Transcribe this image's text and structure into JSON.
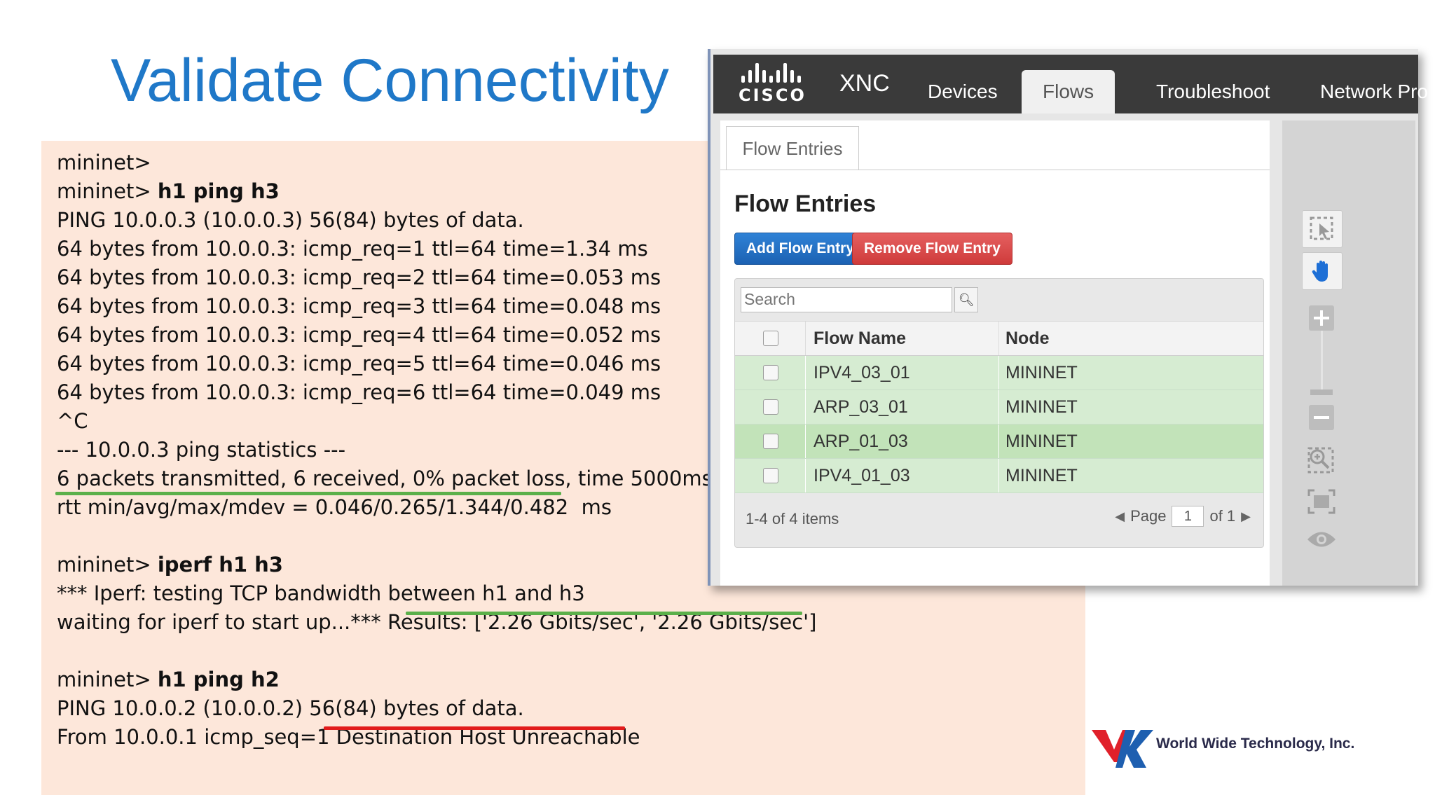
{
  "slide": {
    "title": "Validate Connectivity"
  },
  "terminal": {
    "lines": [
      {
        "prompt": "mininet>",
        "cmd": ""
      },
      {
        "prompt": "mininet> ",
        "cmd": "h1 ping h3"
      },
      {
        "prompt": "PING 10.0.0.3 (10.0.0.3) 56(84) bytes of data.",
        "cmd": ""
      },
      {
        "prompt": "64 bytes from 10.0.0.3: icmp_req=1 ttl=64 time=1.34 ms",
        "cmd": ""
      },
      {
        "prompt": "64 bytes from 10.0.0.3: icmp_req=2 ttl=64 time=0.053 ms",
        "cmd": ""
      },
      {
        "prompt": "64 bytes from 10.0.0.3: icmp_req=3 ttl=64 time=0.048 ms",
        "cmd": ""
      },
      {
        "prompt": "64 bytes from 10.0.0.3: icmp_req=4 ttl=64 time=0.052 ms",
        "cmd": ""
      },
      {
        "prompt": "64 bytes from 10.0.0.3: icmp_req=5 ttl=64 time=0.046 ms",
        "cmd": ""
      },
      {
        "prompt": "64 bytes from 10.0.0.3: icmp_req=6 ttl=64 time=0.049 ms",
        "cmd": ""
      },
      {
        "prompt": "^C",
        "cmd": ""
      },
      {
        "prompt": "--- 10.0.0.3 ping statistics ---",
        "cmd": ""
      },
      {
        "prompt": "6 packets transmitted, 6 received, 0% packet loss, time 5000ms",
        "cmd": ""
      },
      {
        "prompt": "rtt min/avg/max/mdev = 0.046/0.265/1.344/0.482  ms",
        "cmd": ""
      },
      {
        "prompt": "",
        "cmd": ""
      },
      {
        "prompt": "mininet> ",
        "cmd": "iperf h1 h3"
      },
      {
        "prompt": "*** Iperf: testing TCP bandwidth between h1 and h3",
        "cmd": ""
      },
      {
        "prompt": "waiting for iperf to start up...*** Results: ['2.26 Gbits/sec', '2.26 Gbits/sec']",
        "cmd": ""
      },
      {
        "prompt": "",
        "cmd": ""
      },
      {
        "prompt": "mininet> ",
        "cmd": "h1 ping h2"
      },
      {
        "prompt": "PING 10.0.0.2 (10.0.0.2) 56(84) bytes of data.",
        "cmd": ""
      },
      {
        "prompt": "From 10.0.0.1 icmp_seq=1 Destination Host Unreachable",
        "cmd": ""
      }
    ],
    "underline_colors": {
      "ok": "#5bb04a",
      "error": "#e21b1b"
    }
  },
  "xnc": {
    "brand": "cisco",
    "app_name": "XNC",
    "nav_tabs": [
      "Devices",
      "Flows",
      "Troubleshoot",
      "Network Pro"
    ],
    "active_tab": "Flows",
    "subtab": "Flow Entries",
    "section_title": "Flow Entries",
    "add_button": "Add Flow Entry",
    "remove_button": "Remove Flow Entry",
    "search_placeholder": "Search",
    "columns": [
      "Flow Name",
      "Node"
    ],
    "rows": [
      {
        "flow_name": "IPV4_03_01",
        "node": "MININET"
      },
      {
        "flow_name": "ARP_03_01",
        "node": "MININET"
      },
      {
        "flow_name": "ARP_01_03",
        "node": "MININET"
      },
      {
        "flow_name": "IPV4_01_03",
        "node": "MININET"
      }
    ],
    "pagination": {
      "summary": "1-4 of 4 items",
      "page_label": "Page",
      "page": "1",
      "of": "of 1"
    },
    "tools": [
      "select-icon",
      "hand-pan-icon",
      "zoom-in-icon",
      "zoom-out-icon",
      "zoom-region-icon",
      "fit-screen-icon",
      "eye-icon"
    ],
    "colors": {
      "row_green": "#d6ecd2",
      "row_green_selected": "#c2e3b9",
      "add": "#1c62b3",
      "remove": "#cf3b3b"
    }
  },
  "footer": {
    "company": "World Wide Technology, Inc."
  }
}
